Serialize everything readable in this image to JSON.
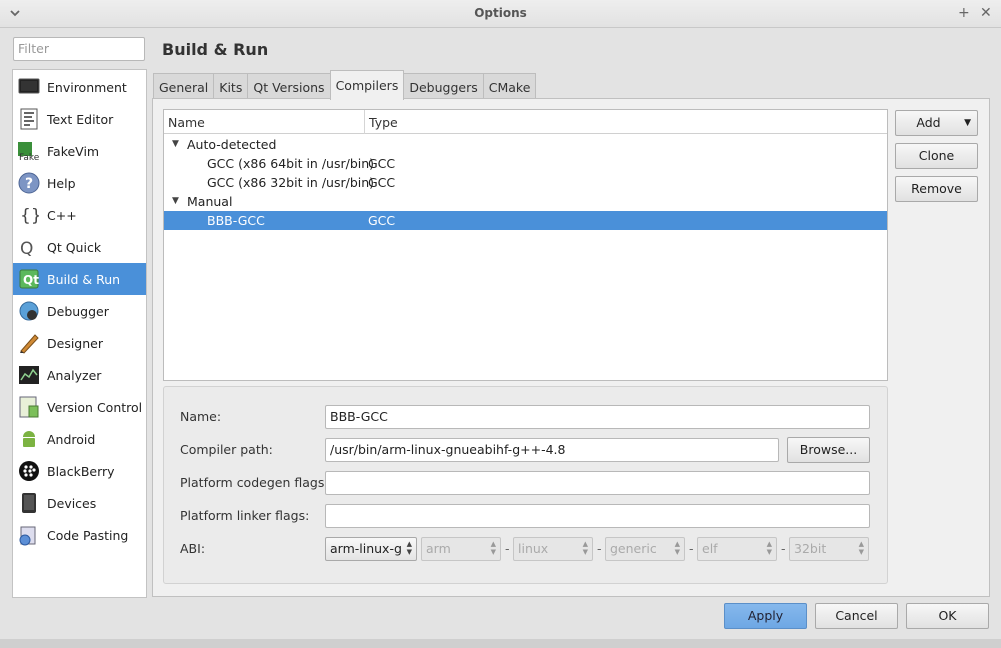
{
  "window": {
    "title": "Options",
    "controls": [
      "+",
      "✕"
    ]
  },
  "filter": {
    "placeholder": "Filter"
  },
  "sidebar": {
    "items": [
      {
        "label": "Environment",
        "icon": "monitor-icon",
        "selected": false
      },
      {
        "label": "Text Editor",
        "icon": "text-editor-icon",
        "selected": false
      },
      {
        "label": "FakeVim",
        "icon": "fakevim-icon",
        "selected": false
      },
      {
        "label": "Help",
        "icon": "help-icon",
        "selected": false
      },
      {
        "label": "C++",
        "icon": "cpp-braces-icon",
        "selected": false
      },
      {
        "label": "Qt Quick",
        "icon": "qt-quick-icon",
        "selected": false
      },
      {
        "label": "Build & Run",
        "icon": "build-run-icon",
        "selected": true
      },
      {
        "label": "Debugger",
        "icon": "debugger-icon",
        "selected": false
      },
      {
        "label": "Designer",
        "icon": "designer-icon",
        "selected": false
      },
      {
        "label": "Analyzer",
        "icon": "analyzer-icon",
        "selected": false
      },
      {
        "label": "Version Control",
        "icon": "version-control-icon",
        "selected": false
      },
      {
        "label": "Android",
        "icon": "android-icon",
        "selected": false
      },
      {
        "label": "BlackBerry",
        "icon": "blackberry-icon",
        "selected": false
      },
      {
        "label": "Devices",
        "icon": "devices-icon",
        "selected": false
      },
      {
        "label": "Code Pasting",
        "icon": "code-pasting-icon",
        "selected": false
      }
    ]
  },
  "page_title": "Build & Run",
  "tabs": [
    {
      "label": "General",
      "active": false
    },
    {
      "label": "Kits",
      "active": false
    },
    {
      "label": "Qt Versions",
      "active": false
    },
    {
      "label": "Compilers",
      "active": true
    },
    {
      "label": "Debuggers",
      "active": false
    },
    {
      "label": "CMake",
      "active": false
    }
  ],
  "compilers": {
    "columns": [
      "Name",
      "Type"
    ],
    "groups": [
      {
        "label": "Auto-detected",
        "items": [
          {
            "name": "GCC (x86 64bit in /usr/bin)",
            "type": "GCC"
          },
          {
            "name": "GCC (x86 32bit in /usr/bin)",
            "type": "GCC"
          }
        ]
      },
      {
        "label": "Manual",
        "items": [
          {
            "name": "BBB-GCC",
            "type": "GCC",
            "selected": true
          }
        ]
      }
    ]
  },
  "actions": {
    "add": "Add",
    "clone": "Clone",
    "remove": "Remove"
  },
  "details": {
    "name_label": "Name:",
    "name_value": "BBB-GCC",
    "compiler_path_label": "Compiler path:",
    "compiler_path_value": "/usr/bin/arm-linux-gnueabihf-g++-4.8",
    "browse_label": "Browse...",
    "codegen_label": "Platform codegen flags:",
    "codegen_value": "",
    "linker_label": "Platform linker flags:",
    "linker_value": "",
    "abi_label": "ABI:",
    "abi": {
      "preset": "arm-linux-g",
      "architecture": "arm",
      "os": "linux",
      "flavor": "generic",
      "format": "elf",
      "width": "32bit"
    }
  },
  "footer": {
    "apply": "Apply",
    "cancel": "Cancel",
    "ok": "OK"
  },
  "colors": {
    "selection": "#4a90d9",
    "apply_button": "#7fb2e8"
  }
}
